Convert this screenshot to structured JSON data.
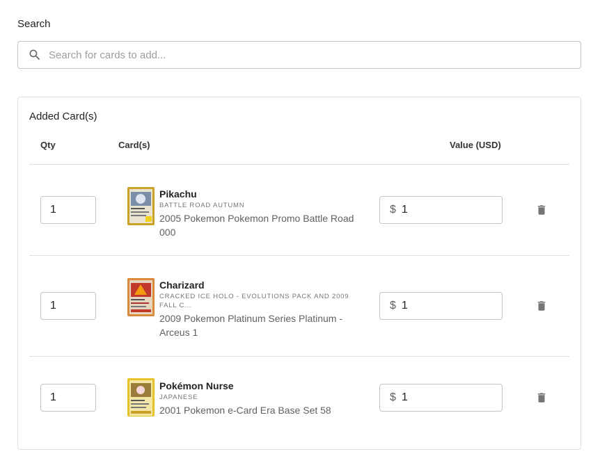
{
  "search": {
    "label": "Search",
    "placeholder": "Search for cards to add..."
  },
  "added": {
    "title": "Added Card(s)",
    "columns": {
      "qty": "Qty",
      "cards": "Card(s)",
      "value": "Value (USD)"
    },
    "currency_symbol": "$",
    "rows": [
      {
        "qty": "1",
        "name": "Pikachu",
        "variant": "BATTLE ROAD AUTUMN",
        "set": "2005 Pokemon Pokemon Promo Battle Road 000",
        "value": "1",
        "thumb_colors": [
          "#c9a227",
          "#7b8fa8"
        ]
      },
      {
        "qty": "1",
        "name": "Charizard",
        "variant": "CRACKED ICE HOLO - EVOLUTIONS PACK AND 2009 FALL C...",
        "set": "2009 Pokemon Platinum Series Platinum - Arceus 1",
        "value": "1",
        "thumb_colors": [
          "#d98a3a",
          "#c0392b"
        ]
      },
      {
        "qty": "1",
        "name": "Pokémon Nurse",
        "variant": "JAPANESE",
        "set": "2001 Pokemon e-Card Era Base Set 58",
        "value": "1",
        "thumb_colors": [
          "#e6c229",
          "#9a7b3a"
        ]
      }
    ]
  },
  "colors": {
    "border": "#c4c4c4",
    "divider": "#e0e0e0",
    "icon": "#757575"
  }
}
